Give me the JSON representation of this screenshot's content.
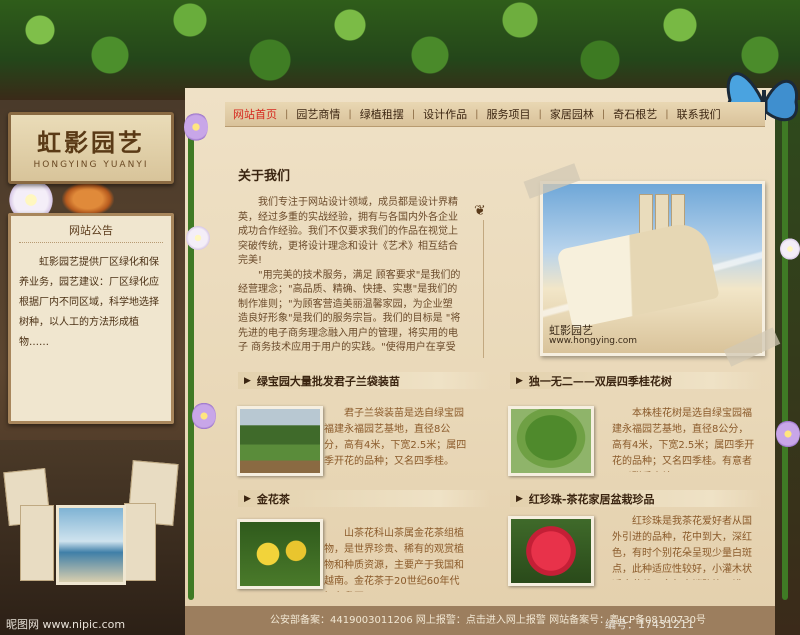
{
  "brand": {
    "name_cn": "虹影园艺",
    "name_en": "HONGYING YUANYI"
  },
  "nav": {
    "items": [
      "网站首页",
      "园艺商情",
      "绿植租摆",
      "设计作品",
      "服务项目",
      "家居园林",
      "奇石根艺",
      "联系我们"
    ],
    "active_index": 0
  },
  "notice": {
    "title": "网站公告",
    "body": "虹影园艺提供厂区绿化和保养业务，园艺建议：厂区绿化应根据厂内不同区域，科学地选择树种，以人工的方法形成植物……"
  },
  "about": {
    "title": "关于我们",
    "paragraphs": [
      "我们专注于网站设计领域，成员都是设计界精英，经过多重的实战经验，拥有与各国内外各企业成功合作经验。我们不仅要求我们的作品在视觉上突破传统，更将设计理念和设计《艺术》相互结合完美!",
      "\"用完美的技术服务，满足 顾客要求\"是我们的经营理念；\"高品质、精确、快捷、实惠\"是我们的制作准则；\"为顾客营造美丽温馨家园，为企业塑造良好形象\"是我们的服务宗旨。我们的目标是 \"将先进的电子商务理念融入用户的管理，将实用的电子 商务技术应用于用户的实践。\"使得用户在享受信息科"
    ],
    "photo_caption_cn": "虹影园艺",
    "photo_caption_url": "www.hongying.com"
  },
  "products": [
    {
      "title": "绿宝园大量批发君子兰袋装苗",
      "text": "君子兰袋装苗是选自绿宝园福建永福园艺基地，直径8公分，高有4米，下宽2.5米；属四季开花的品种；又名四季桂。"
    },
    {
      "title": "独一无二——双层四季桂花树",
      "text": "本株桂花树是选自绿宝园福建永福园艺基地，直径8公分，高有4米，下宽2.5米；属四季开花的品种；又名四季桂。有意者可以联系本站。"
    },
    {
      "title": "金花茶",
      "text": "山茶花科山茶属金花茶组植物，是世界珍贵、稀有的观赏植物和种质资源，主要产于我国和越南。金花茶于20世纪60年代初在我国……"
    },
    {
      "title": "红珍珠-茶花家居盆栽珍品",
      "text": "红珍珠是我茶花爱好者从国外引进的品种，花中到大，深红色，有时个别花朵呈现少量白斑点，此种适应性较好，小灌木状适合盆栽，多年来销路均不错，证明该种已被大众……"
    }
  ],
  "footer": {
    "text": "公安部备案：4419003011206  网上报警：点击进入网上报警  网站备案号：粤ICP备08100730号"
  },
  "watermark": {
    "left": "昵图网 www.nipic.com",
    "right": "编号：17431211"
  },
  "colors": {
    "nav_active": "#d6281e",
    "panel_bg": "#efe1c6",
    "leaf_green": "#3f7a25"
  }
}
